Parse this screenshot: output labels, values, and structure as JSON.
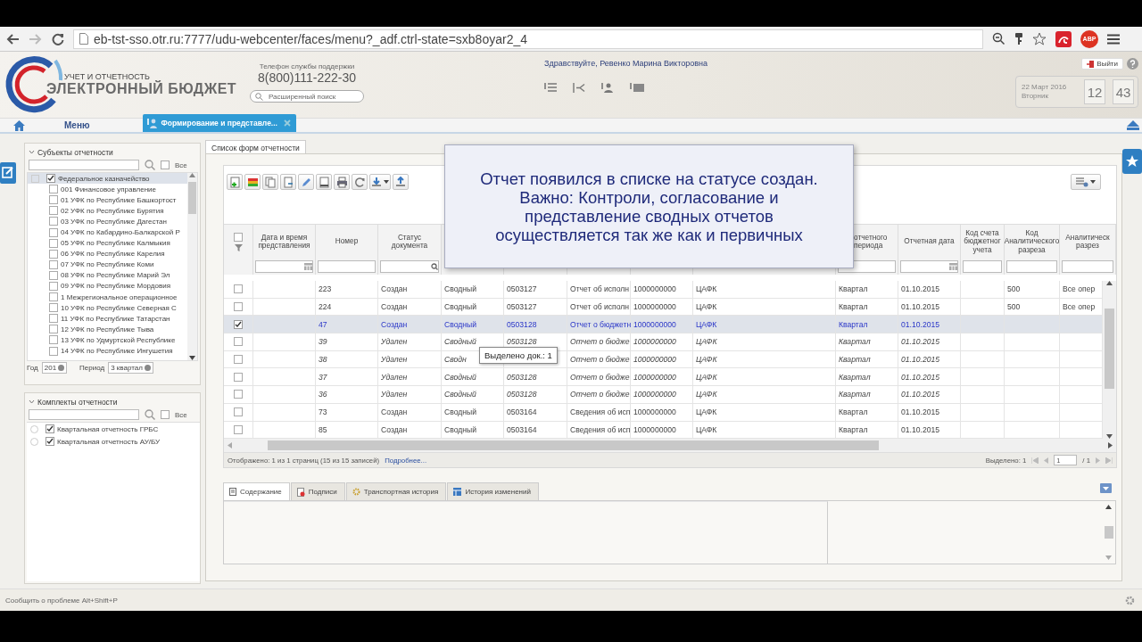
{
  "browser": {
    "url": "eb-tst-sso.otr.ru:7777/udu-webcenter/faces/menu?_adf.ctrl-state=sxb8oyar2_4",
    "extension_badge": "ABP"
  },
  "header": {
    "logo_subtitle": "УЧЕТ И ОТЧЕТНОСТЬ",
    "logo_title": "ЭЛЕКТРОННЫЙ БЮДЖЕТ",
    "support_label": "Телефон службы поддержки",
    "support_phone": "8(800)111-222-30",
    "search": {
      "placeholder": "Расширенный поиск"
    },
    "greeting": "Здравствуйте, Ревенко Марина Викторовна",
    "logout": "Выйти",
    "date": "22 Март 2016",
    "weekday": "Вторник",
    "hours": "12",
    "minutes": "43"
  },
  "nav": {
    "menu": "Меню",
    "tabs": [
      {
        "label": "Формирование и представле...",
        "selected": true
      }
    ]
  },
  "left": {
    "subjects": {
      "title": "Субъекты отчетности",
      "all_label": "Все",
      "all_checked": false,
      "tree": [
        {
          "label": "Федеральное казначейство",
          "checked": true,
          "selected": true,
          "children": [
            {
              "label": "001 Финансовое управление",
              "checked": false,
              "selected": false
            },
            {
              "label": "01 УФК по Республике Башкортост",
              "checked": false,
              "selected": false
            },
            {
              "label": "02 УФК по Республике Бурятия",
              "checked": false,
              "selected": false
            },
            {
              "label": "03 УФК по Республике Дагестан",
              "checked": false,
              "selected": false
            },
            {
              "label": "04 УФК по Кабардино-Балкарской Р",
              "checked": false,
              "selected": false
            },
            {
              "label": "05 УФК по Республике Калмыкия",
              "checked": false,
              "selected": false
            },
            {
              "label": "06 УФК по Республике Карелия",
              "checked": false,
              "selected": false
            },
            {
              "label": "07 УФК по Республике Коми",
              "checked": false,
              "selected": false
            },
            {
              "label": "08 УФК по Республике Марий Эл",
              "checked": false,
              "selected": false
            },
            {
              "label": "09 УФК по Республике Мордовия",
              "checked": false,
              "selected": false
            },
            {
              "label": "1 Межрегиональное операционное",
              "checked": false,
              "selected": false
            },
            {
              "label": "10 УФК по Республике Северная С",
              "checked": false,
              "selected": false
            },
            {
              "label": "11 УФК по Республике Татарстан",
              "checked": false,
              "selected": false
            },
            {
              "label": "12 УФК по Республике Тыва",
              "checked": false,
              "selected": false
            },
            {
              "label": "13 УФК по Удмуртской Республике",
              "checked": false,
              "selected": false
            },
            {
              "label": "14 УФК по Республике Ингушетия",
              "checked": false,
              "selected": false
            }
          ]
        }
      ],
      "year_label": "Год",
      "year": "201",
      "period_label": "Период",
      "period": "3 квартал"
    },
    "kits": {
      "title": "Комплекты отчетности",
      "all_label": "Все",
      "all_checked": false,
      "items": [
        {
          "label": "Квартальная отчетность ГРБС",
          "checked": true
        },
        {
          "label": "Квартальная отчетность АУ/БУ",
          "checked": true
        }
      ]
    }
  },
  "main": {
    "tab": "Список форм отчетности",
    "select_all_checked": false,
    "columns": [
      {
        "kind": "date",
        "label": "Дата и время представления"
      },
      {
        "kind": "text",
        "label": "Номер"
      },
      {
        "kind": "lookup",
        "label": "Статус документа"
      },
      {
        "kind": "covered"
      },
      {
        "kind": "covered"
      },
      {
        "kind": "covered"
      },
      {
        "kind": "covered"
      },
      {
        "kind": "covered"
      },
      {
        "kind": "partial",
        "label": "отчетного периода"
      },
      {
        "kind": "date",
        "label": "Отчетная дата"
      },
      {
        "kind": "text",
        "label": "Код счета бюджетног учета"
      },
      {
        "kind": "text",
        "label": "Код Аналитического разреза"
      },
      {
        "kind": "text",
        "label": "Аналитическ разрез"
      }
    ],
    "rows": [
      {
        "checked": false,
        "selected": false,
        "deleted": false,
        "number": "223",
        "status": "Создан",
        "type": "Сводный",
        "form_code": "0503127",
        "form_name": "Отчет об исполн",
        "code": "1000000000",
        "organization": "ЦАФК",
        "period": "Квартал",
        "report_date": "01.10.2015",
        "analytic_code": "500",
        "analytic_section": "Все опер"
      },
      {
        "checked": false,
        "selected": false,
        "deleted": false,
        "number": "224",
        "status": "Создан",
        "type": "Сводный",
        "form_code": "0503127",
        "form_name": "Отчет об исполн",
        "code": "1000000000",
        "organization": "ЦАФК",
        "period": "Квартал",
        "report_date": "01.10.2015",
        "analytic_code": "500",
        "analytic_section": "Все опер"
      },
      {
        "checked": true,
        "selected": true,
        "deleted": false,
        "number": "47",
        "status": "Создан",
        "type": "Сводный",
        "form_code": "0503128",
        "form_name": "Отчет о бюджетн",
        "code": "1000000000",
        "organization": "ЦАФК",
        "period": "Квартал",
        "report_date": "01.10.2015"
      },
      {
        "checked": false,
        "selected": false,
        "deleted": true,
        "number": "39",
        "status": "Удален",
        "type": "Сводный",
        "form_code": "0503128",
        "form_name": "Отчет о бюдже",
        "code": "1000000000",
        "organization": "ЦАФК",
        "period": "Квартал",
        "report_date": "01.10.2015"
      },
      {
        "checked": false,
        "selected": false,
        "deleted": true,
        "number": "38",
        "status": "Удален",
        "type": "Сводн",
        "form_name": "Отчет о бюдже",
        "code": "1000000000",
        "organization": "ЦАФК",
        "period": "Квартал",
        "report_date": "01.10.2015"
      },
      {
        "checked": false,
        "selected": false,
        "deleted": true,
        "number": "37",
        "status": "Удален",
        "type": "Сводный",
        "form_code": "0503128",
        "form_name": "Отчет о бюдже",
        "code": "1000000000",
        "organization": "ЦАФК",
        "period": "Квартал",
        "report_date": "01.10.2015"
      },
      {
        "checked": false,
        "selected": false,
        "deleted": true,
        "number": "36",
        "status": "Удален",
        "type": "Сводный",
        "form_code": "0503128",
        "form_name": "Отчет о бюдже",
        "code": "1000000000",
        "organization": "ЦАФК",
        "period": "Квартал",
        "report_date": "01.10.2015"
      },
      {
        "checked": false,
        "selected": false,
        "deleted": false,
        "number": "73",
        "status": "Создан",
        "type": "Сводный",
        "form_code": "0503164",
        "form_name": "Сведения об исп",
        "code": "1000000000",
        "organization": "ЦАФК",
        "period": "Квартал",
        "report_date": "01.10.2015"
      },
      {
        "checked": false,
        "selected": false,
        "deleted": false,
        "number": "85",
        "status": "Создан",
        "type": "Сводный",
        "form_code": "0503164",
        "form_name": "Сведения об исп",
        "code": "1000000000",
        "organization": "ЦАФК",
        "period": "Квартал",
        "report_date": "01.10.2015"
      }
    ],
    "pager": {
      "shown": "Отображено: 1 из 1 страниц (15 из 15 записей)",
      "more": "Подробнее...",
      "selected": "Выделено: 1",
      "page": "1",
      "total": "/ 1"
    },
    "detail_tabs": [
      {
        "kind": "content",
        "label": "Содержание",
        "selected": true
      },
      {
        "kind": "signatures",
        "label": "Подписи",
        "selected": false
      },
      {
        "kind": "transport",
        "label": "Транспортная история",
        "selected": false
      },
      {
        "kind": "changes",
        "label": "История изменений",
        "selected": false
      }
    ]
  },
  "popup": {
    "lines": [
      "Отчет появился в списке на статусе создан.",
      "Важно: Контроли, согласование и",
      "представление сводных отчетов",
      "осуществляется так же как и первичных"
    ]
  },
  "tooltip": "Выделено док.: 1",
  "status_bar": "Сообщить о проблеме Alt+Shift+P"
}
